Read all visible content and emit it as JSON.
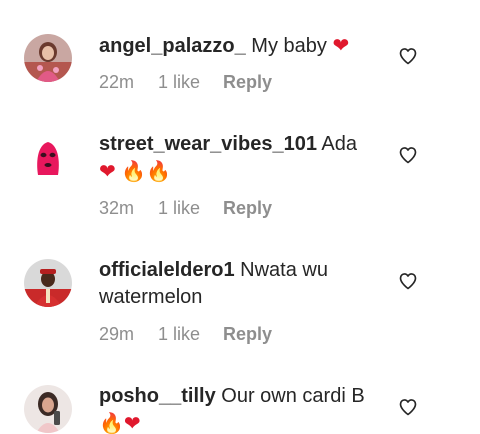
{
  "comments": [
    {
      "username": "angel_palazzo_",
      "text": "My baby",
      "emoji": "❤",
      "emoji2": "",
      "time": "22m",
      "likes": "1 like",
      "reply": "Reply",
      "avatar": "avatar-woman-pink-dress"
    },
    {
      "username": "street_wear_vibes_101",
      "text": "Ada",
      "emoji": "❤",
      "emoji2": "🔥🔥",
      "time": "32m",
      "likes": "1 like",
      "reply": "Reply",
      "avatar": "avatar-pink-balaclava"
    },
    {
      "username": "officialeldero1",
      "text": "Nwata wu watermelon",
      "time": "29m",
      "likes": "1 like",
      "reply": "Reply",
      "avatar": "avatar-man-red-outfit"
    },
    {
      "username": "posho__tilly",
      "text": "Our own cardi B",
      "emoji": "🔥",
      "emoji2": "❤",
      "time": "",
      "likes": "",
      "reply": "",
      "avatar": "avatar-woman-selfie"
    }
  ],
  "icons": {
    "like": "heart-outline-icon"
  },
  "colors": {
    "text": "#262626",
    "meta": "#8e8e8e",
    "heart": "#e0182d",
    "fire": "#f26a1b"
  }
}
